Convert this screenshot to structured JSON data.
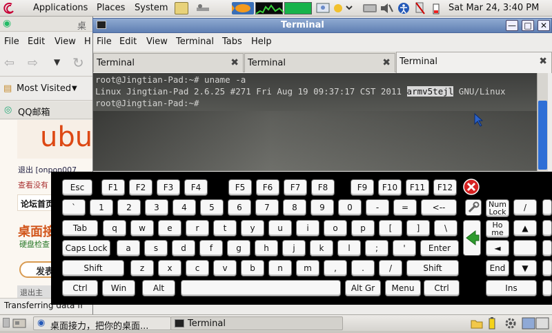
{
  "top_panel": {
    "menus": [
      "Applications",
      "Places",
      "System"
    ],
    "clock": "Sat Mar 24,  3:40 PM"
  },
  "firefox": {
    "title": "桌",
    "menus": [
      "File",
      "Edit",
      "View",
      "H"
    ],
    "bookmark": "Most Visited",
    "tab": "QQ邮箱",
    "page_logo": "ubu",
    "page_lines": [
      "退出 [onpon007",
      "查看没有",
      "论坛首页",
      "桌面接",
      "硬盘检查",
      "发表",
      "退出主"
    ],
    "status": "Transferring data fr"
  },
  "terminal": {
    "title": "Terminal",
    "menus": [
      "File",
      "Edit",
      "View",
      "Terminal",
      "Tabs",
      "Help"
    ],
    "tabs": [
      {
        "label": "Terminal",
        "close": "✖"
      },
      {
        "label": "Terminal",
        "close": "✖"
      },
      {
        "label": "Terminal",
        "close": "✖"
      }
    ],
    "lines": [
      "root@Jingtian-Pad:~# uname -a",
      "Linux Jingtian-Pad 2.6.25 #271 Fri Aug 19 09:37:17 CST 2011 ",
      "armv5tejl",
      " GNU/Linux",
      "root@Jingtian-Pad:~# "
    ]
  },
  "keyboard": {
    "row1": [
      "Esc",
      "F1",
      "F2",
      "F3",
      "F4",
      "F5",
      "F6",
      "F7",
      "F8",
      "F9",
      "F10",
      "F11",
      "F12"
    ],
    "row2": [
      "`",
      "1",
      "2",
      "3",
      "4",
      "5",
      "6",
      "7",
      "8",
      "9",
      "0",
      "-",
      "=",
      "<--"
    ],
    "row3": [
      "Tab",
      "q",
      "w",
      "e",
      "r",
      "t",
      "y",
      "u",
      "i",
      "o",
      "p",
      "[",
      "]",
      "\\"
    ],
    "row4": [
      "Caps Lock",
      "a",
      "s",
      "d",
      "f",
      "g",
      "h",
      "j",
      "k",
      "l",
      ";",
      "'",
      "Enter"
    ],
    "row5": [
      "Shift",
      "z",
      "x",
      "c",
      "v",
      "b",
      "n",
      "m",
      ",",
      ".",
      "/",
      "Shift"
    ],
    "row6": [
      "Ctrl",
      "Win",
      "Alt",
      "",
      "Alt Gr",
      "Menu",
      "Ctrl"
    ],
    "nav": {
      "num_lock": [
        "Num",
        "Lock"
      ],
      "slash": "/",
      "home": [
        "Ho",
        "me"
      ],
      "up": "▲",
      "left": "◄",
      "end": "End",
      "down": "▼",
      "ins": "Ins"
    }
  },
  "bottom_panel": {
    "tasks": [
      "桌面接力，把你的桌面...",
      "Terminal"
    ]
  },
  "colors": {
    "title_bar": "#5f7fb3",
    "close_key": "#d62222",
    "enter_arrow": "#2e9b2e",
    "scroll_thumb": "#2f6fd6"
  }
}
